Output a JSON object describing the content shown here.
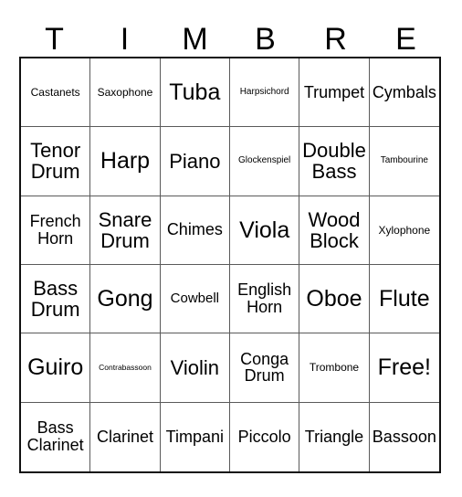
{
  "card": {
    "title_letters": [
      "T",
      "I",
      "M",
      "B",
      "R",
      "E"
    ],
    "columns": 6,
    "rows": 6,
    "border_color": "#111111",
    "grid_line_color": "#5a5a5a",
    "text_color": "#000000",
    "background_color": "#ffffff",
    "free_space_label": "Free!",
    "free_space_position": {
      "row": 5,
      "column": 6
    }
  },
  "grid": {
    "rows": [
      [
        {
          "label": "Castanets",
          "size": "xs"
        },
        {
          "label": "Saxophone",
          "size": "xs"
        },
        {
          "label": "Tuba",
          "size": "xl"
        },
        {
          "label": "Harpsichord",
          "size": "xxs"
        },
        {
          "label": "Trumpet",
          "size": "md"
        },
        {
          "label": "Cymbals",
          "size": "md"
        }
      ],
      [
        {
          "label": "Tenor Drum",
          "size": "lg"
        },
        {
          "label": "Harp",
          "size": "xl"
        },
        {
          "label": "Piano",
          "size": "lg"
        },
        {
          "label": "Glockenspiel",
          "size": "xxs"
        },
        {
          "label": "Double Bass",
          "size": "lg"
        },
        {
          "label": "Tambourine",
          "size": "xxs"
        }
      ],
      [
        {
          "label": "French Horn",
          "size": "md"
        },
        {
          "label": "Snare Drum",
          "size": "lg"
        },
        {
          "label": "Chimes",
          "size": "md"
        },
        {
          "label": "Viola",
          "size": "xl"
        },
        {
          "label": "Wood Block",
          "size": "lg"
        },
        {
          "label": "Xylophone",
          "size": "xs"
        }
      ],
      [
        {
          "label": "Bass Drum",
          "size": "lg"
        },
        {
          "label": "Gong",
          "size": "xl"
        },
        {
          "label": "Cowbell",
          "size": "sm"
        },
        {
          "label": "English Horn",
          "size": "md"
        },
        {
          "label": "Oboe",
          "size": "xl"
        },
        {
          "label": "Flute",
          "size": "xl"
        }
      ],
      [
        {
          "label": "Guiro",
          "size": "xl"
        },
        {
          "label": "Contrabassoon",
          "size": "tiny"
        },
        {
          "label": "Violin",
          "size": "lg"
        },
        {
          "label": "Conga Drum",
          "size": "md"
        },
        {
          "label": "Trombone",
          "size": "xs"
        },
        {
          "label": "Free!",
          "size": "xl"
        }
      ],
      [
        {
          "label": "Bass Clarinet",
          "size": "md"
        },
        {
          "label": "Clarinet",
          "size": "md"
        },
        {
          "label": "Timpani",
          "size": "md"
        },
        {
          "label": "Piccolo",
          "size": "md"
        },
        {
          "label": "Triangle",
          "size": "md"
        },
        {
          "label": "Bassoon",
          "size": "md"
        }
      ]
    ]
  }
}
